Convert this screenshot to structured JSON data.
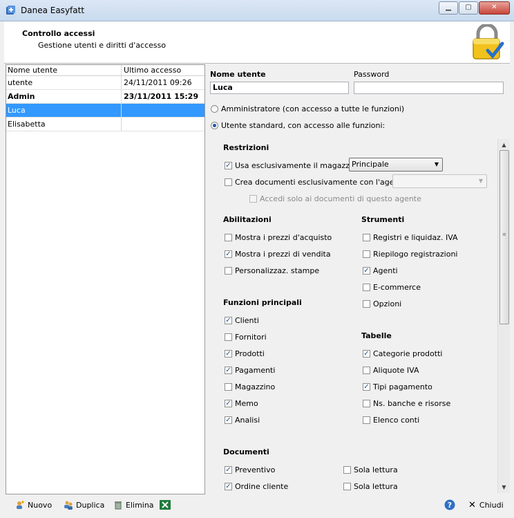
{
  "window": {
    "title": "Danea Easyfatt"
  },
  "header": {
    "title": "Controllo accessi",
    "subtitle": "Gestione utenti e diritti d'accesso"
  },
  "users_list": {
    "columns": [
      "Nome utente",
      "Ultimo accesso"
    ],
    "rows": [
      {
        "name": "utente",
        "last": "24/11/2011  09:26"
      },
      {
        "name": "Admin",
        "last": "23/11/2011  15:29"
      },
      {
        "name": "Luca",
        "last": ""
      },
      {
        "name": "Elisabetta",
        "last": ""
      }
    ]
  },
  "form": {
    "username_label": "Nome utente",
    "username_value": "Luca",
    "password_label": "Password",
    "password_value": "",
    "radio_admin": "Amministratore (con accesso a tutte le funzioni)",
    "radio_standard": "Utente standard, con accesso alle funzioni:"
  },
  "restrizioni": {
    "title": "Restrizioni",
    "magazzino_label": "Usa esclusivamente il magazzino",
    "magazzino_value": "Principale",
    "agente_label": "Crea documenti esclusivamente con l'agente",
    "agente_only_label": "Accedi solo ai documenti di questo agente"
  },
  "abilitazioni": {
    "title": "Abilitazioni",
    "items": [
      "Mostra i prezzi d'acquisto",
      "Mostra i prezzi di vendita",
      "Personalizzaz. stampe"
    ],
    "checked": [
      false,
      true,
      false
    ]
  },
  "strumenti": {
    "title": "Strumenti",
    "items": [
      "Registri e liquidaz. IVA",
      "Riepilogo registrazioni",
      "Agenti",
      "E-commerce",
      "Opzioni"
    ],
    "checked": [
      false,
      false,
      true,
      false,
      false
    ]
  },
  "funzioni": {
    "title": "Funzioni principali",
    "items": [
      "Clienti",
      "Fornitori",
      "Prodotti",
      "Pagamenti",
      "Magazzino",
      "Memo",
      "Analisi"
    ],
    "checked": [
      true,
      false,
      true,
      true,
      false,
      true,
      true
    ]
  },
  "tabelle": {
    "title": "Tabelle",
    "items": [
      "Categorie prodotti",
      "Aliquote IVA",
      "Tipi pagamento",
      "Ns. banche e risorse",
      "Elenco conti"
    ],
    "checked": [
      true,
      false,
      true,
      false,
      false
    ]
  },
  "documenti": {
    "title": "Documenti",
    "items": [
      "Preventivo",
      "Ordine cliente"
    ],
    "checked": [
      true,
      true
    ],
    "readonly_label": "Sola lettura"
  },
  "toolbar": {
    "nuovo": "Nuovo",
    "duplica": "Duplica",
    "elimina": "Elimina",
    "chiudi": "Chiudi"
  },
  "check_glyph": "✓"
}
